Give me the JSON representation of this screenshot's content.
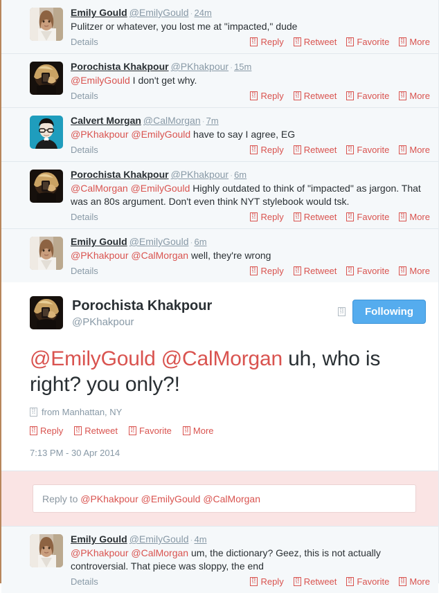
{
  "theme": {
    "accent_red": "#d9534f",
    "link_grey": "#8899a6",
    "follow_blue": "#55acee",
    "context_bg": "#f5f8fa",
    "reply_band_bg": "#fae4e4"
  },
  "actions": {
    "details_label": "Details",
    "reply_label": "Reply",
    "retweet_label": "Retweet",
    "favorite_label": "Favorite",
    "more_label": "More",
    "reply_glyph_hi": "F0",
    "reply_glyph_lo": "51",
    "retweet_glyph_hi": "F0",
    "retweet_glyph_lo": "52",
    "favorite_glyph_hi": "F0",
    "favorite_glyph_lo": "41",
    "more_glyph_hi": "F0",
    "more_glyph_lo": "50"
  },
  "ancestors": [
    {
      "fullname": "Emily Gould",
      "handle": "@EmilyGould",
      "time": "24m",
      "avatar": "emily-gould-avatar",
      "text_parts": [
        {
          "type": "text",
          "value": "Pulitzer or whatever, you lost me at \"impacted,\" dude"
        }
      ]
    },
    {
      "fullname": "Porochista Khakpour",
      "handle": "@PKhakpour",
      "time": "15m",
      "avatar": "porochista-khakpour-avatar",
      "text_parts": [
        {
          "type": "mention",
          "value": "@EmilyGould"
        },
        {
          "type": "text",
          "value": " I don't get why."
        }
      ]
    },
    {
      "fullname": "Calvert Morgan",
      "handle": "@CalMorgan",
      "time": "7m",
      "avatar": "calvert-morgan-avatar",
      "text_parts": [
        {
          "type": "mention",
          "value": "@PKhakpour"
        },
        {
          "type": "text",
          "value": " "
        },
        {
          "type": "mention",
          "value": "@EmilyGould"
        },
        {
          "type": "text",
          "value": " have to say I agree, EG"
        }
      ]
    },
    {
      "fullname": "Porochista Khakpour",
      "handle": "@PKhakpour",
      "time": "6m",
      "avatar": "porochista-khakpour-avatar",
      "text_parts": [
        {
          "type": "mention",
          "value": "@CalMorgan"
        },
        {
          "type": "text",
          "value": " "
        },
        {
          "type": "mention",
          "value": "@EmilyGould"
        },
        {
          "type": "text",
          "value": " Highly outdated to think of \"impacted\" as jargon. That was an 80s argument. Don't even think NYT stylebook would tsk."
        }
      ]
    },
    {
      "fullname": "Emily Gould",
      "handle": "@EmilyGould",
      "time": "6m",
      "avatar": "emily-gould-avatar",
      "text_parts": [
        {
          "type": "mention",
          "value": "@PKhakpour"
        },
        {
          "type": "text",
          "value": " "
        },
        {
          "type": "mention",
          "value": "@CalMorgan"
        },
        {
          "type": "text",
          "value": " well, they're wrong"
        }
      ]
    }
  ],
  "main_tweet": {
    "fullname": "Porochista Khakpour",
    "handle": "@PKhakpour",
    "avatar": "porochista-khakpour-avatar",
    "follow_button_label": "Following",
    "follow_glyph_hi": "F0",
    "follow_glyph_lo": "59",
    "text_parts": [
      {
        "type": "mention",
        "value": "@EmilyGould"
      },
      {
        "type": "text",
        "value": " "
      },
      {
        "type": "mention",
        "value": "@CalMorgan"
      },
      {
        "type": "text",
        "value": " uh, who is right? you only?!"
      }
    ],
    "geo_label": "from Manhattan, NY",
    "geo_glyph_hi": "F0",
    "geo_glyph_lo": "31",
    "timestamp": "7:13 PM - 30 Apr 2014"
  },
  "reply_composer": {
    "prefix": "Reply to ",
    "mentions": [
      "@PKhakpour",
      "@EmilyGould",
      "@CalMorgan"
    ],
    "placeholder": "Reply to @PKhakpour @EmilyGould @CalMorgan"
  },
  "descendants": [
    {
      "fullname": "Emily Gould",
      "handle": "@EmilyGould",
      "time": "4m",
      "avatar": "emily-gould-avatar",
      "text_parts": [
        {
          "type": "mention",
          "value": "@PKhakpour"
        },
        {
          "type": "text",
          "value": " "
        },
        {
          "type": "mention",
          "value": "@CalMorgan"
        },
        {
          "type": "text",
          "value": " um, the dictionary? Geez, this is not actually controversial. That piece was sloppy, the end"
        }
      ]
    }
  ]
}
